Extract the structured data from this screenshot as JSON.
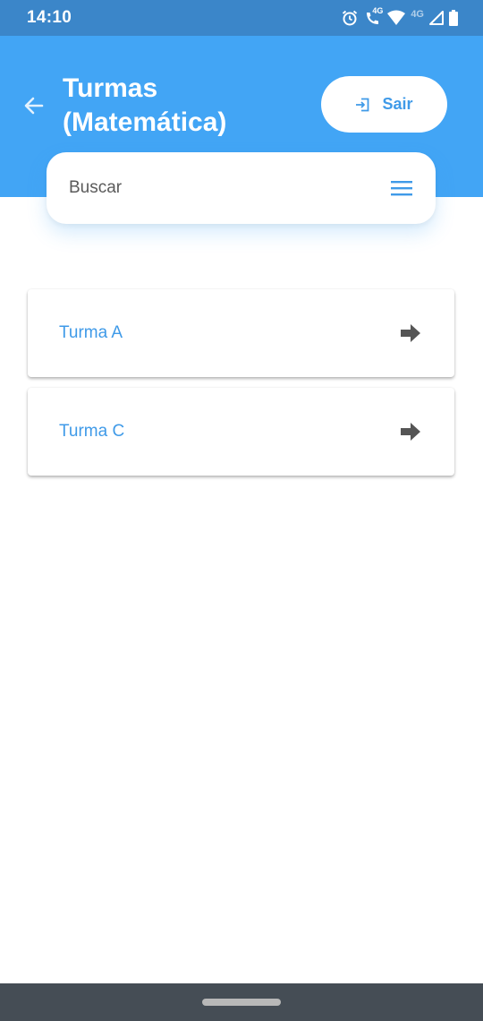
{
  "status_bar": {
    "time": "14:10",
    "icons": [
      "alarm-icon",
      "volte-call-icon",
      "wifi-icon",
      "signal-4g-icon",
      "battery-icon"
    ],
    "network_label": "4G",
    "call_label": "4G"
  },
  "header": {
    "title_line1": "Turmas",
    "title_line2": "(Matemática)",
    "back_icon": "arrow-left-icon",
    "logout_label": "Sair",
    "logout_icon": "exit-icon",
    "background_color": "#42a5f5"
  },
  "search": {
    "placeholder": "Buscar",
    "menu_icon": "hamburger-menu-icon"
  },
  "classes": [
    {
      "name": "Turma A",
      "icon": "arrow-right-icon"
    },
    {
      "name": "Turma C",
      "icon": "arrow-right-icon"
    }
  ],
  "colors": {
    "accent": "#3f9ae8",
    "status_bar": "#3b86c9",
    "nav_bar": "#454d55"
  }
}
